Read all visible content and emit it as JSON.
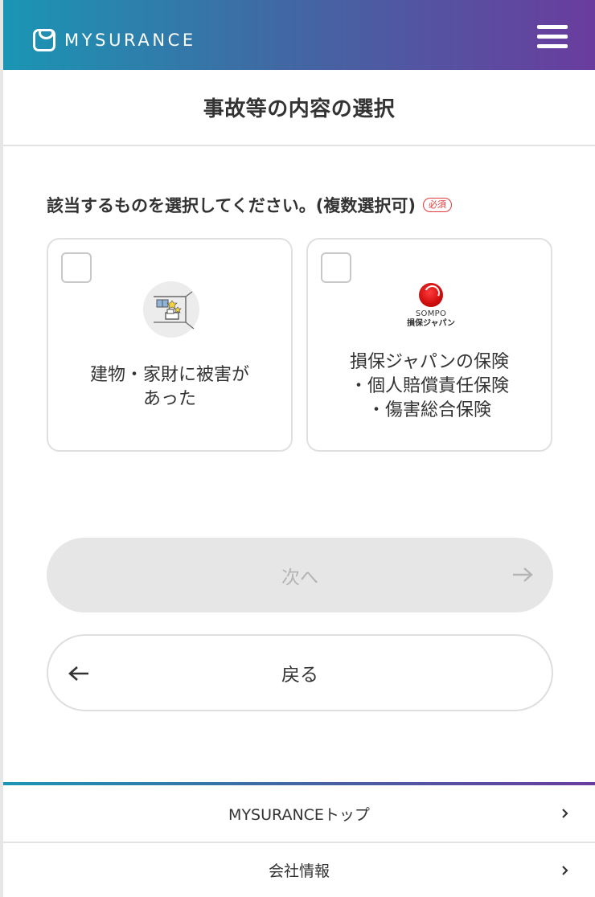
{
  "header": {
    "logo_text": "MYSURANCE",
    "logo_icon": "mysurance-logo-icon",
    "menu_icon": "hamburger-menu-icon",
    "gradient_start": "#1a96b4",
    "gradient_end": "#6a3c9e"
  },
  "page": {
    "title": "事故等の内容の選択"
  },
  "question": {
    "label": "該当するものを選択してください。(複数選択可)",
    "required_badge": "必須"
  },
  "options": [
    {
      "label": "建物・家財に被害が\nあった",
      "icon": "house-damage-icon",
      "checked": false
    },
    {
      "label": "損保ジャパンの保険\n・個人賠償責任保険\n・傷害総合保険",
      "icon": "sompo-logo",
      "logo_line1": "SOMPO",
      "logo_line2": "損保ジャパン",
      "checked": false
    }
  ],
  "buttons": {
    "next_label": "次へ",
    "next_icon": "arrow-right-icon",
    "back_label": "戻る",
    "back_icon": "arrow-left-icon"
  },
  "footer": {
    "links": [
      {
        "label": "MYSURANCEトップ",
        "icon": "chevron-right-icon"
      },
      {
        "label": "会社情報",
        "icon": "chevron-right-icon"
      }
    ]
  }
}
